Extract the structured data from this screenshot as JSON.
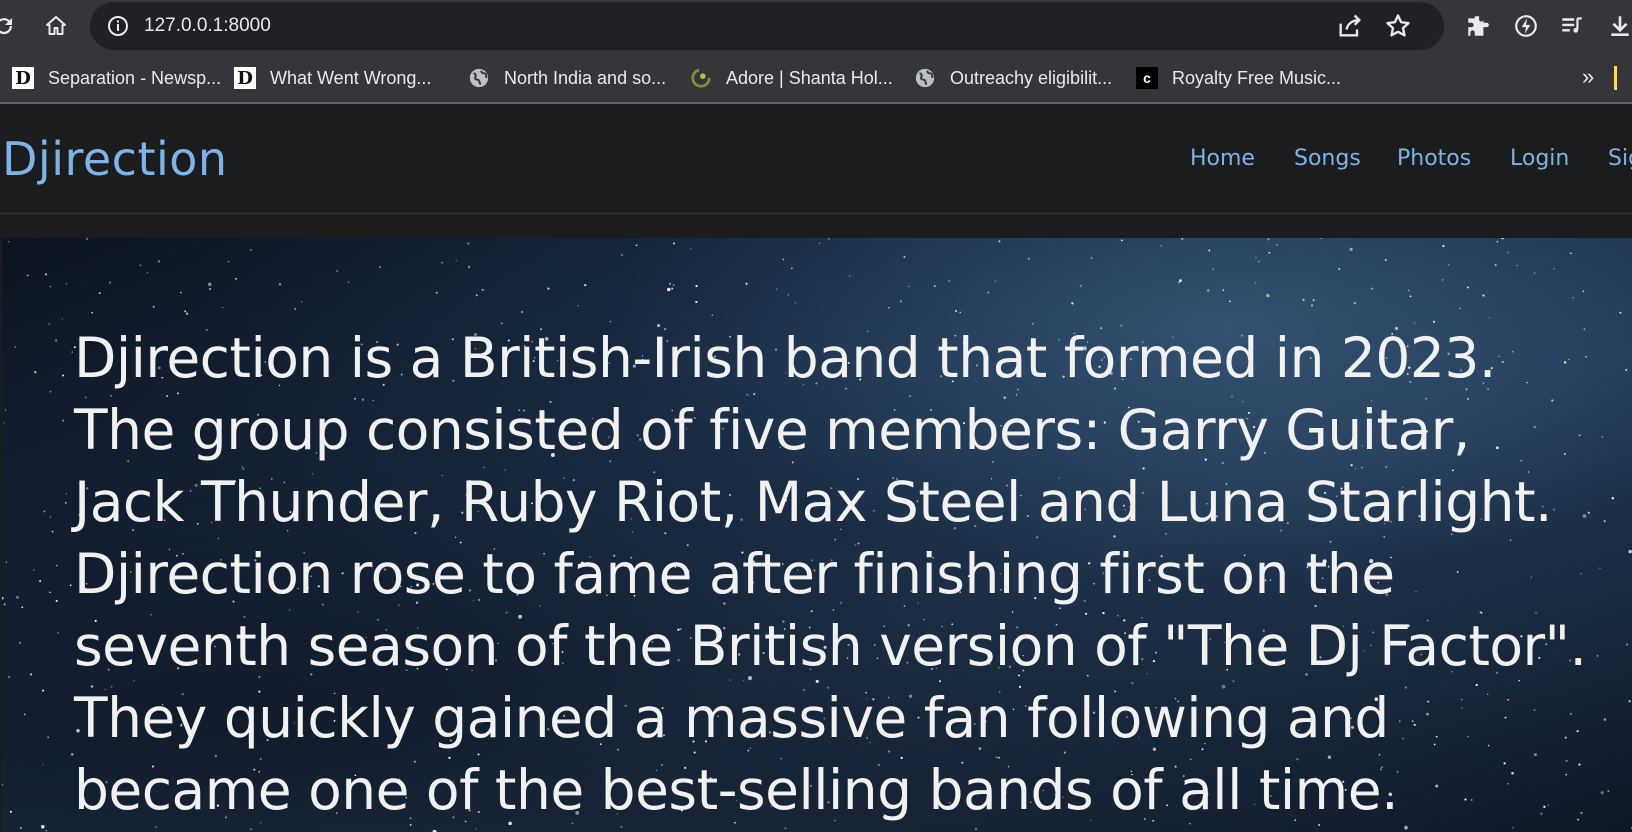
{
  "browser": {
    "url": "127.0.0.1:8000",
    "bookmarks": [
      {
        "label": "Separation - Newsp...",
        "icon": "d-logo-icon"
      },
      {
        "label": "What Went Wrong...",
        "icon": "d-logo-icon"
      },
      {
        "label": "North India and so...",
        "icon": "globe-icon"
      },
      {
        "label": "Adore | Shanta Hol...",
        "icon": "site-logo-icon"
      },
      {
        "label": "Outreachy eligibilit...",
        "icon": "globe-icon"
      },
      {
        "label": "Royalty Free Music...",
        "icon": "c-logo-icon"
      }
    ],
    "more_bookmarks_label": "»"
  },
  "site": {
    "brand": "Djirection",
    "nav": [
      {
        "label": "Home"
      },
      {
        "label": "Songs"
      },
      {
        "label": "Photos"
      },
      {
        "label": "Login"
      },
      {
        "label": "Sig"
      }
    ]
  },
  "hero": {
    "lines": [
      "Djirection is a British-Irish band that formed in 2023.",
      "The group consisted of five members: Garry Guitar,",
      "Jack Thunder, Ruby Riot, Max Steel and Luna Starlight.",
      "Djirection rose to fame after finishing first on the",
      "seventh season of the British version of \"The Dj Factor\".",
      "They quickly gained a massive fan following and",
      "became one of the best-selling bands of all time."
    ]
  },
  "colors": {
    "accent": "#7fb3e6",
    "page_background": "#1b1c1e",
    "chrome_background": "#353639"
  }
}
